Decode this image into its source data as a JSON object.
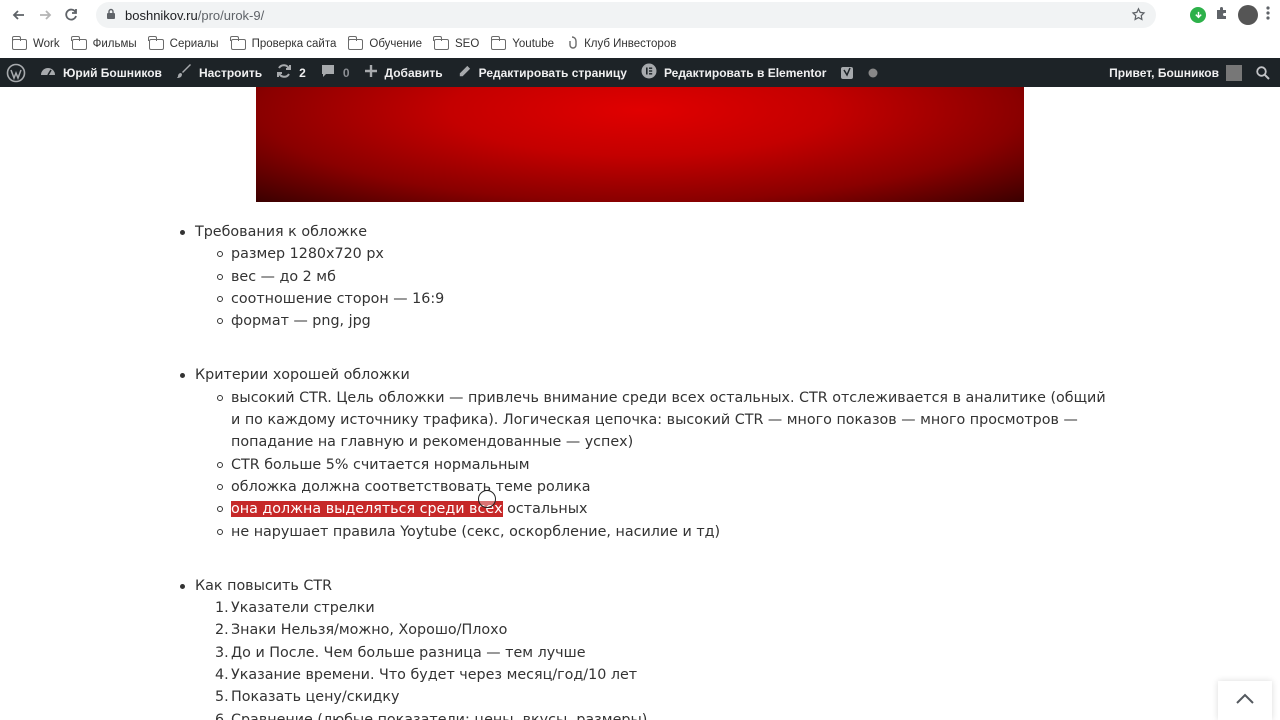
{
  "browser": {
    "url_host": "boshnikov.ru",
    "url_path": "/pro/urok-9/"
  },
  "bookmarks": [
    {
      "label": "Work",
      "icon": "folder-icon"
    },
    {
      "label": "Фильмы",
      "icon": "folder-icon"
    },
    {
      "label": "Сериалы",
      "icon": "folder-icon"
    },
    {
      "label": "Проверка сайта",
      "icon": "folder-icon"
    },
    {
      "label": "Обучение",
      "icon": "folder-icon"
    },
    {
      "label": "SEO",
      "icon": "folder-icon"
    },
    {
      "label": "Youtube",
      "icon": "folder-icon"
    },
    {
      "label": "Клуб Инвесторов",
      "icon": "link-icon"
    }
  ],
  "adminbar": {
    "site_name": "Юрий Бошников",
    "customize": "Настроить",
    "updates_count": "2",
    "comments_count": "0",
    "add_new": "Добавить",
    "edit_page": "Редактировать страницу",
    "edit_elementor": "Редактировать в Elementor",
    "greeting": "Привет, Бошников"
  },
  "article": {
    "sections": [
      {
        "title": "Требования к обложке",
        "items": [
          "размер 1280х720 px",
          "вес — до 2 мб",
          "соотношение сторон — 16:9",
          "формат — png, jpg"
        ]
      },
      {
        "title": "Критерии хорошей обложки",
        "items": [
          "высокий CTR. Цель обложки — привлечь внимание среди всех остальных. CTR отслеживается в аналитике (общий и по каждому источнику трафика). Логическая цепочка: высокий CTR — много показов — много просмотров — попадание на главную и рекомендованные — успех)",
          "CTR больше 5% считается нормальным",
          "обложка должна соответствовать теме ролика",
          "не нарушает правила Yoytube (секс, оскорбление, насилие и тд)"
        ],
        "highlight_item": {
          "highlighted": "она должна выделяться среди всех",
          "rest": " остальных"
        }
      },
      {
        "title": "Как повысить CTR",
        "items": [
          "Указатели стрелки",
          "Знаки Нельзя/можно, Хорошо/Плохо",
          "До и После. Чем больше разница — тем лучше",
          "Указание времени. Что будет через месяц/год/10 лет",
          "Показать цену/скидку",
          "Сравнение (любые показатели: цены, вкусы, размеры)"
        ]
      }
    ]
  },
  "colors": {
    "admin_bar": "#1d2327",
    "highlight": "#c62828",
    "hero_red": "#c40000"
  }
}
